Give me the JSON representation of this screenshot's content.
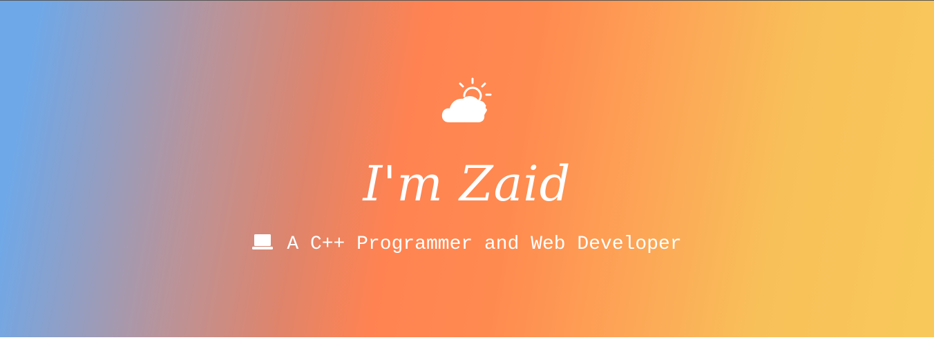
{
  "hero": {
    "title": "I'm Zaid",
    "subtitle": "A C++ Programmer and Web Developer",
    "weather_icon": "cloud-sun-icon",
    "subtitle_icon": "laptop-icon",
    "gradient_colors": [
      "#6fa8e8",
      "#ff8352",
      "#f8c95a"
    ],
    "text_color": "#ffffff"
  }
}
